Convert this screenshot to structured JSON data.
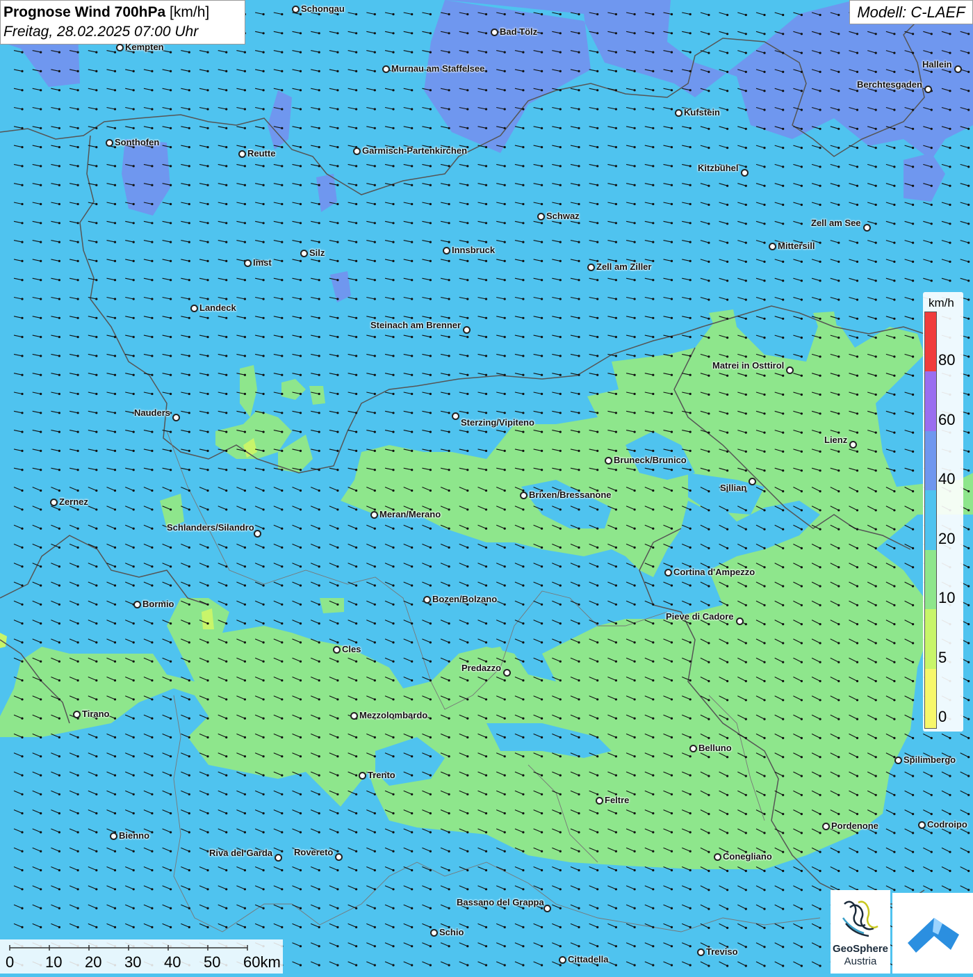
{
  "header": {
    "title_bold": "Prognose Wind 700hPa",
    "title_unit": "[km/h]",
    "subtitle": "Freitag, 28.02.2025 07:00 Uhr"
  },
  "model": {
    "label": "Modell: C-LAEF"
  },
  "legend": {
    "unit": "km/h",
    "ticks": [
      "0",
      "5",
      "10",
      "20",
      "40",
      "60",
      "80"
    ],
    "colors": [
      "#f7f76b",
      "#c8f56a",
      "#8ee68c",
      "#4fc3ef",
      "#6f97ef",
      "#9a6ef0",
      "#f03c3c"
    ]
  },
  "scale": {
    "labels": [
      "0",
      "10",
      "20",
      "30",
      "40",
      "50",
      "60km"
    ]
  },
  "logos": {
    "geosphere_line1": "GeoSphere",
    "geosphere_line2": "Austria"
  },
  "colors": {
    "wind_10_20": "#8ee68c",
    "wind_20_40": "#4fc3ef",
    "wind_40_60": "#6f97ef",
    "border": "#555555"
  },
  "places": [
    {
      "name": "Schongau"
    },
    {
      "name": "Kempten"
    },
    {
      "name": "Bad Tölz"
    },
    {
      "name": "Murnau am Staffelsee"
    },
    {
      "name": "Hallein"
    },
    {
      "name": "Berchtesgaden"
    },
    {
      "name": "Kufstein"
    },
    {
      "name": "Sonthofen"
    },
    {
      "name": "Reutte"
    },
    {
      "name": "Garmisch-Partenkirchen"
    },
    {
      "name": "Kitzbühel"
    },
    {
      "name": "Schwaz"
    },
    {
      "name": "Zell am See"
    },
    {
      "name": "Mittersill"
    },
    {
      "name": "Innsbruck"
    },
    {
      "name": "Silz"
    },
    {
      "name": "Imst"
    },
    {
      "name": "Zell am Ziller"
    },
    {
      "name": "Landeck"
    },
    {
      "name": "Steinach am Brenner"
    },
    {
      "name": "Matrei in Osttirol"
    },
    {
      "name": "Nauders"
    },
    {
      "name": "Sterzing/Vipiteno"
    },
    {
      "name": "Lienz"
    },
    {
      "name": "Bruneck/Brunico"
    },
    {
      "name": "Sillian"
    },
    {
      "name": "Brixen/Bressanone"
    },
    {
      "name": "Zernez"
    },
    {
      "name": "Meran/Merano"
    },
    {
      "name": "Schlanders/Silandro"
    },
    {
      "name": "Cortina d'Ampezzo"
    },
    {
      "name": "Bormio"
    },
    {
      "name": "Bozen/Bolzano"
    },
    {
      "name": "Pieve di Cadore"
    },
    {
      "name": "Cles"
    },
    {
      "name": "Predazzo"
    },
    {
      "name": "Tirano"
    },
    {
      "name": "Mezzolombardo"
    },
    {
      "name": "Belluno"
    },
    {
      "name": "Spilimbergo"
    },
    {
      "name": "Trento"
    },
    {
      "name": "Feltre"
    },
    {
      "name": "Pordenone"
    },
    {
      "name": "Codroipo"
    },
    {
      "name": "Bienno"
    },
    {
      "name": "Riva del Garda"
    },
    {
      "name": "Rovereto"
    },
    {
      "name": "Conegliano"
    },
    {
      "name": "Bassano del Grappa"
    },
    {
      "name": "Schio"
    },
    {
      "name": "Treviso"
    },
    {
      "name": "Cittadella"
    }
  ]
}
